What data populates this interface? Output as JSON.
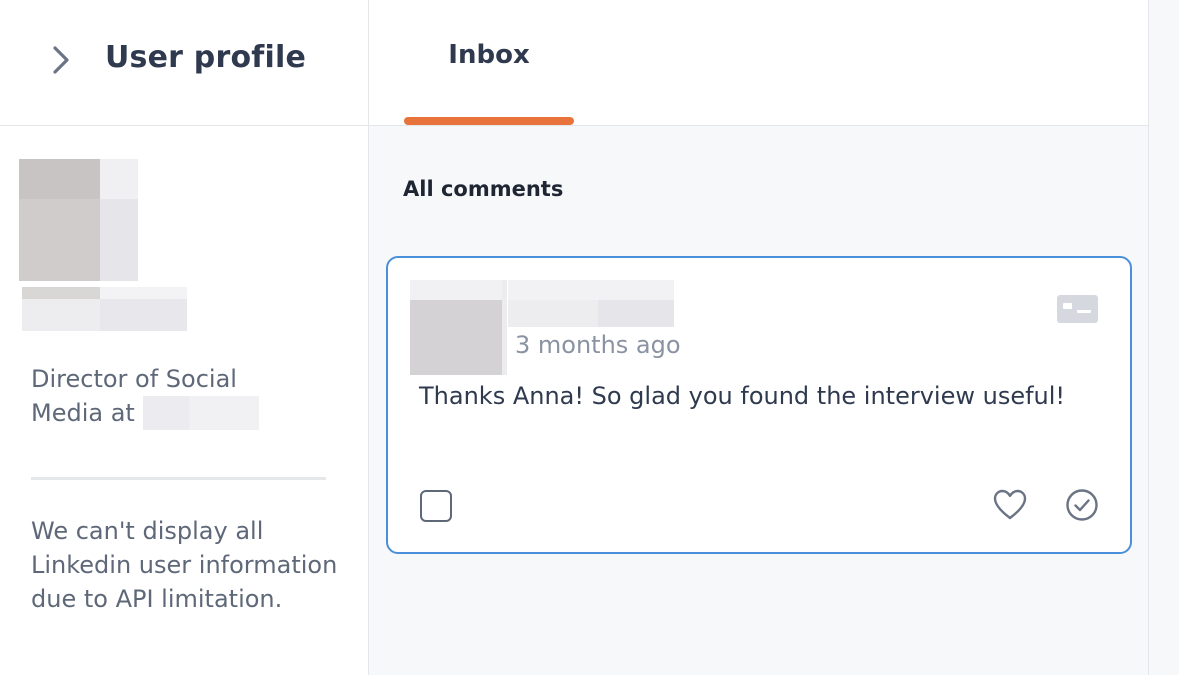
{
  "left_panel": {
    "title": "User profile",
    "icon_expand": "chevron-right-icon",
    "job_title_line1": "Director of Social",
    "job_title_line2": "Media at",
    "api_note": "We can't display all Linkedin user information due to API limitation."
  },
  "main": {
    "tabs": [
      {
        "label": "Inbox",
        "active": true
      }
    ],
    "section_title": "All comments",
    "comment": {
      "timestamp": "3 months ago",
      "text": "Thanks Anna! So glad you found the interview useful!",
      "icons": {
        "profile_card": "id-card-icon",
        "like": "heart-icon",
        "resolve": "check-circle-icon"
      }
    }
  },
  "colors": {
    "accent": "#e8743b",
    "card_border": "#4a8fd9",
    "title_text": "#2f3a4f",
    "muted_text": "#5e6878",
    "timestamp_text": "#8a93a2",
    "main_background": "#f7f8fa"
  }
}
